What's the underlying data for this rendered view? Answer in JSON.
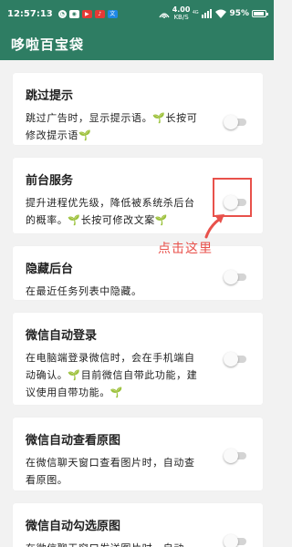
{
  "status_bar": {
    "time": "12:57:13",
    "network_speed_value": "4.00",
    "network_speed_unit": "KB/S",
    "network_type": "4G",
    "battery_percent": "95%",
    "battery_level": 0.95,
    "notification_icons": [
      "message-icon",
      "chat-icon",
      "video-icon",
      "music-icon",
      "translate-icon"
    ]
  },
  "app_bar": {
    "title": "哆啦百宝袋"
  },
  "cards": [
    {
      "title": "跳过提示",
      "desc": "跳过广告时，显示提示语。🌱长按可修改提示语🌱",
      "enabled": false
    },
    {
      "title": "前台服务",
      "desc": "提升进程优先级，降低被系统杀后台的概率。🌱长按可修改文案🌱",
      "enabled": false
    },
    {
      "title": "隐藏后台",
      "desc": "在最近任务列表中隐藏。",
      "enabled": false
    },
    {
      "title": "微信自动登录",
      "desc": "在电脑端登录微信时，会在手机端自动确认。🌱目前微信自带此功能，建议使用自带功能。🌱",
      "enabled": false
    },
    {
      "title": "微信自动查看原图",
      "desc": "在微信聊天窗口查看图片时，自动查看原图。",
      "enabled": false
    },
    {
      "title": "微信自动勾选原图",
      "desc": "在微信聊天窗口发送图片时，自动",
      "enabled": false
    }
  ],
  "annotation": {
    "text": "点击这里",
    "color": "#e8514b"
  },
  "colors": {
    "primary": "#2e7d63",
    "background": "#f2f2f2",
    "annotation": "#e8514b"
  }
}
